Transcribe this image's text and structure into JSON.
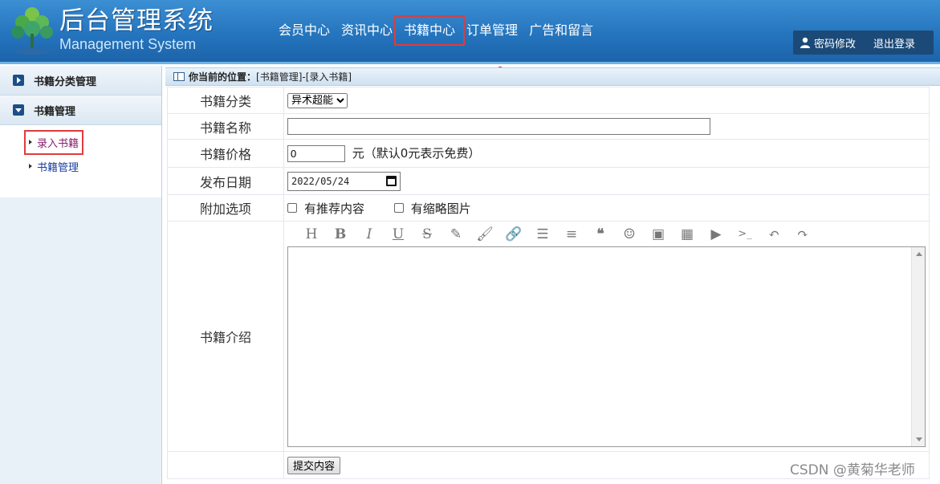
{
  "header": {
    "title": "后台管理系统",
    "subtitle": "Management System",
    "nav": [
      "会员中心",
      "资讯中心",
      "书籍中心",
      "订单管理",
      "广告和留言"
    ],
    "highlighted_nav": "书籍中心",
    "password_label": "密码修改",
    "logout_label": "退出登录"
  },
  "sidebar": {
    "group1": "书籍分类管理",
    "group2": "书籍管理",
    "items": [
      "录入书籍",
      "书籍管理"
    ]
  },
  "breadcrumb": {
    "label": "你当前的位置：",
    "path": "[书籍管理]-[录入书籍]"
  },
  "form": {
    "category_label": "书籍分类",
    "category_value": "异术超能",
    "name_label": "书籍名称",
    "name_value": "",
    "price_label": "书籍价格",
    "price_value": "0",
    "price_hint": "元（默认0元表示免费）",
    "date_label": "发布日期",
    "date_value": "2022/05/24",
    "options_label": "附加选项",
    "option1": "有推荐内容",
    "option2": "有缩略图片",
    "intro_label": "书籍介绍",
    "submit_label": "提交内容"
  },
  "watermark": "CSDN @黄菊华老师"
}
